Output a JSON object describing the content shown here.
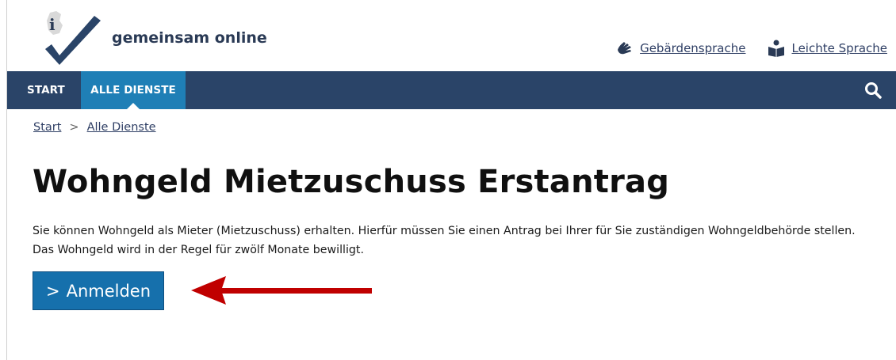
{
  "header": {
    "brand": "gemeinsam online",
    "links": {
      "sign_language": "Gebärdensprache",
      "easy_language": "Leichte Sprache"
    }
  },
  "nav": {
    "start": "START",
    "all_services": "ALLE DIENSTE",
    "search_icon": "search-icon"
  },
  "breadcrumb": {
    "start": "Start",
    "separator": ">",
    "current": "Alle Dienste"
  },
  "main": {
    "title": "Wohngeld Mietzuschuss Erstantrag",
    "description_line1": "Sie können Wohngeld als Mieter (Mietzuschuss) erhalten. Hierfür müssen Sie einen Antrag bei Ihrer für Sie zuständigen Wohngeldbehörde stellen.",
    "description_line2": "Das Wohngeld wird in der Regel für zwölf Monate bewilligt.",
    "login_button": "Anmelden",
    "login_chevron": ">"
  },
  "colors": {
    "nav_bg": "#2a4468",
    "nav_active": "#1f7fb6",
    "button_bg": "#1670ac",
    "arrow": "#c00000",
    "link": "#2e3e64"
  }
}
